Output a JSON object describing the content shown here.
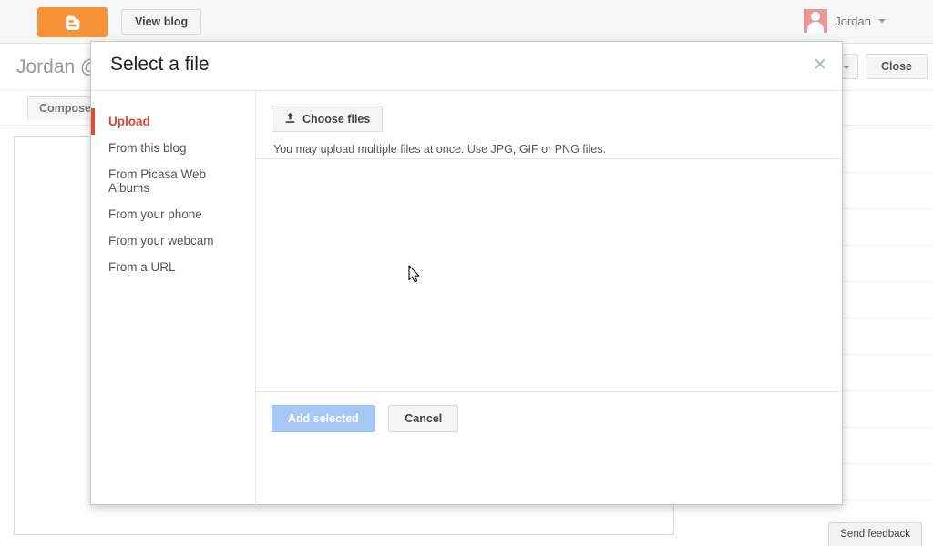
{
  "topbar": {
    "logo_icon": "blogger-logo-icon",
    "view_blog_label": "View blog",
    "user_name": "Jordan",
    "user_caret_icon": "chevron-down-icon",
    "avatar_icon": "avatar-person-icon"
  },
  "page": {
    "blog_title": "Jordan @",
    "close_label": "Close",
    "compose_tab_label": "Compose",
    "send_feedback_label": "Send feedback"
  },
  "modal": {
    "title": "Select a file",
    "close_icon": "close-icon",
    "sidebar": [
      {
        "label": "Upload",
        "active": true
      },
      {
        "label": "From this blog",
        "active": false
      },
      {
        "label": "From Picasa Web Albums",
        "active": false
      },
      {
        "label": "From your phone",
        "active": false
      },
      {
        "label": "From your webcam",
        "active": false
      },
      {
        "label": "From a URL",
        "active": false
      }
    ],
    "upload": {
      "choose_files_label": "Choose files",
      "choose_files_icon": "upload-icon",
      "hint": "You may upload multiple files at once. Use JPG, GIF or PNG files."
    },
    "footer": {
      "add_selected_label": "Add selected",
      "cancel_label": "Cancel"
    }
  },
  "colors": {
    "brand_orange": "#f79239",
    "accent_red": "#dd4b39",
    "primary_disabled_blue": "#a6c8f7"
  }
}
